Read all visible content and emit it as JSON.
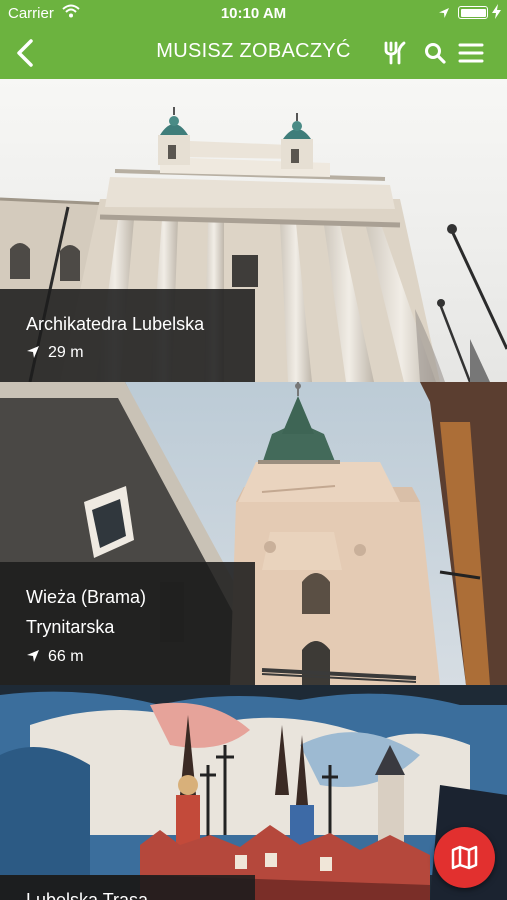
{
  "status_bar": {
    "carrier": "Carrier",
    "time": "10:10 AM",
    "battery_level": 1.0
  },
  "header": {
    "title": "MUSISZ ZOBACZYĆ",
    "back_icon": "back-chevron-icon",
    "icons": [
      "fork-knife-icon",
      "search-icon",
      "menu-icon"
    ]
  },
  "places": [
    {
      "name": "Archikatedra Lubelska",
      "distance": "29 m"
    },
    {
      "name_line1": "Wieża (Brama)",
      "name_line2": "Trynitarska",
      "distance": "66 m"
    },
    {
      "name": "Lubelska Trasa"
    }
  ],
  "map_button": {
    "icon": "map-icon",
    "color": "#e2302f"
  },
  "colors": {
    "accent": "#6cb33f"
  }
}
